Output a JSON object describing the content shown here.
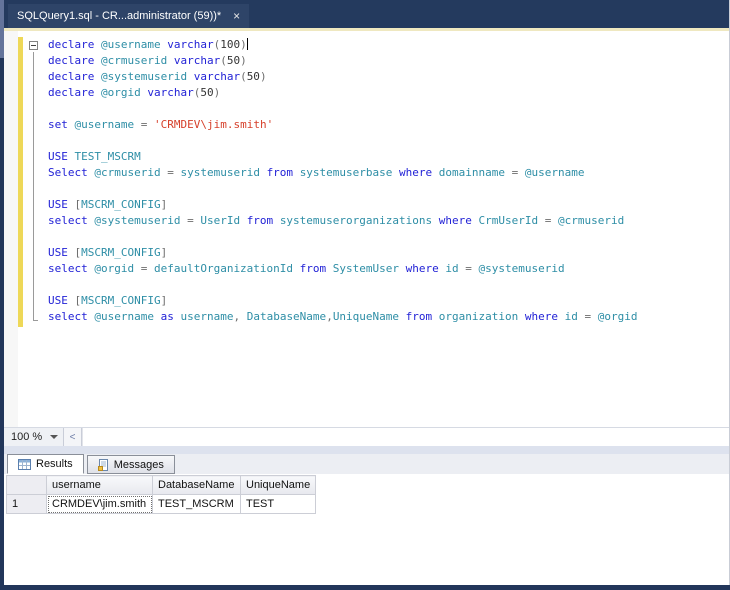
{
  "window": {
    "tab_title": "SQLQuery1.sql - CR...administrator (59))*",
    "close_label": "×"
  },
  "editor": {
    "zoom_level": "100 %",
    "scroll_left_arrow": "<",
    "colors": {
      "kw": "#2222d6",
      "id": "#2e8ea6",
      "op": "#6e6e6e",
      "num": "#333333",
      "str": "#d6402b"
    },
    "code_lines": [
      {
        "cursor": true,
        "tokens": [
          {
            "t": "declare ",
            "c": "kw"
          },
          {
            "t": "@username ",
            "c": "id"
          },
          {
            "t": "varchar",
            "c": "kw"
          },
          {
            "t": "(",
            "c": "op"
          },
          {
            "t": "100",
            "c": "num"
          },
          {
            "t": ")",
            "c": "op"
          }
        ]
      },
      {
        "tokens": [
          {
            "t": "declare ",
            "c": "kw"
          },
          {
            "t": "@crmuserid ",
            "c": "id"
          },
          {
            "t": "varchar",
            "c": "kw"
          },
          {
            "t": "(",
            "c": "op"
          },
          {
            "t": "50",
            "c": "num"
          },
          {
            "t": ")",
            "c": "op"
          }
        ]
      },
      {
        "tokens": [
          {
            "t": "declare ",
            "c": "kw"
          },
          {
            "t": "@systemuserid ",
            "c": "id"
          },
          {
            "t": "varchar",
            "c": "kw"
          },
          {
            "t": "(",
            "c": "op"
          },
          {
            "t": "50",
            "c": "num"
          },
          {
            "t": ")",
            "c": "op"
          }
        ]
      },
      {
        "tokens": [
          {
            "t": "declare ",
            "c": "kw"
          },
          {
            "t": "@orgid ",
            "c": "id"
          },
          {
            "t": "varchar",
            "c": "kw"
          },
          {
            "t": "(",
            "c": "op"
          },
          {
            "t": "50",
            "c": "num"
          },
          {
            "t": ")",
            "c": "op"
          }
        ]
      },
      {
        "tokens": []
      },
      {
        "tokens": [
          {
            "t": "set ",
            "c": "kw"
          },
          {
            "t": "@username ",
            "c": "id"
          },
          {
            "t": "= ",
            "c": "op"
          },
          {
            "t": "'CRMDEV\\jim.smith'",
            "c": "str"
          }
        ]
      },
      {
        "tokens": []
      },
      {
        "tokens": [
          {
            "t": "USE ",
            "c": "kw"
          },
          {
            "t": "TEST_MSCRM",
            "c": "id"
          }
        ]
      },
      {
        "tokens": [
          {
            "t": "Select ",
            "c": "kw"
          },
          {
            "t": "@crmuserid ",
            "c": "id"
          },
          {
            "t": "= ",
            "c": "op"
          },
          {
            "t": "systemuserid ",
            "c": "id"
          },
          {
            "t": "from ",
            "c": "kw"
          },
          {
            "t": "systemuserbase ",
            "c": "id"
          },
          {
            "t": "where ",
            "c": "kw"
          },
          {
            "t": "domainname ",
            "c": "id"
          },
          {
            "t": "= ",
            "c": "op"
          },
          {
            "t": "@username",
            "c": "id"
          }
        ]
      },
      {
        "tokens": []
      },
      {
        "tokens": [
          {
            "t": "USE ",
            "c": "kw"
          },
          {
            "t": "[",
            "c": "op"
          },
          {
            "t": "MSCRM_CONFIG",
            "c": "id"
          },
          {
            "t": "]",
            "c": "op"
          }
        ]
      },
      {
        "tokens": [
          {
            "t": "select ",
            "c": "kw"
          },
          {
            "t": "@systemuserid ",
            "c": "id"
          },
          {
            "t": "= ",
            "c": "op"
          },
          {
            "t": "UserId ",
            "c": "id"
          },
          {
            "t": "from ",
            "c": "kw"
          },
          {
            "t": "systemuserorganizations ",
            "c": "id"
          },
          {
            "t": "where ",
            "c": "kw"
          },
          {
            "t": "CrmUserId ",
            "c": "id"
          },
          {
            "t": "= ",
            "c": "op"
          },
          {
            "t": "@crmuserid",
            "c": "id"
          }
        ]
      },
      {
        "tokens": []
      },
      {
        "tokens": [
          {
            "t": "USE ",
            "c": "kw"
          },
          {
            "t": "[",
            "c": "op"
          },
          {
            "t": "MSCRM_CONFIG",
            "c": "id"
          },
          {
            "t": "]",
            "c": "op"
          }
        ]
      },
      {
        "tokens": [
          {
            "t": "select ",
            "c": "kw"
          },
          {
            "t": "@orgid ",
            "c": "id"
          },
          {
            "t": "= ",
            "c": "op"
          },
          {
            "t": "defaultOrganizationId ",
            "c": "id"
          },
          {
            "t": "from ",
            "c": "kw"
          },
          {
            "t": "SystemUser ",
            "c": "id"
          },
          {
            "t": "where ",
            "c": "kw"
          },
          {
            "t": "id ",
            "c": "id"
          },
          {
            "t": "= ",
            "c": "op"
          },
          {
            "t": "@systemuserid",
            "c": "id"
          }
        ]
      },
      {
        "tokens": []
      },
      {
        "tokens": [
          {
            "t": "USE ",
            "c": "kw"
          },
          {
            "t": "[",
            "c": "op"
          },
          {
            "t": "MSCRM_CONFIG",
            "c": "id"
          },
          {
            "t": "]",
            "c": "op"
          }
        ]
      },
      {
        "tokens": [
          {
            "t": "select ",
            "c": "kw"
          },
          {
            "t": "@username ",
            "c": "id"
          },
          {
            "t": "as ",
            "c": "kw"
          },
          {
            "t": "username",
            "c": "id"
          },
          {
            "t": ", ",
            "c": "op"
          },
          {
            "t": "DatabaseName",
            "c": "id"
          },
          {
            "t": ",",
            "c": "op"
          },
          {
            "t": "UniqueName ",
            "c": "id"
          },
          {
            "t": "from ",
            "c": "kw"
          },
          {
            "t": "organization ",
            "c": "id"
          },
          {
            "t": "where ",
            "c": "kw"
          },
          {
            "t": "id ",
            "c": "id"
          },
          {
            "t": "= ",
            "c": "op"
          },
          {
            "t": "@orgid",
            "c": "id"
          }
        ]
      }
    ]
  },
  "results": {
    "tabs": [
      {
        "label": "Results",
        "icon": "results-grid-icon"
      },
      {
        "label": "Messages",
        "icon": "messages-page-icon"
      }
    ],
    "active_tab": "Results",
    "grid": {
      "columns": [
        "username",
        "DatabaseName",
        "UniqueName"
      ],
      "rows": [
        {
          "num": "1",
          "cells": [
            "CRMDEV\\jim.smith",
            "TEST_MSCRM",
            "TEST"
          ]
        }
      ]
    }
  }
}
